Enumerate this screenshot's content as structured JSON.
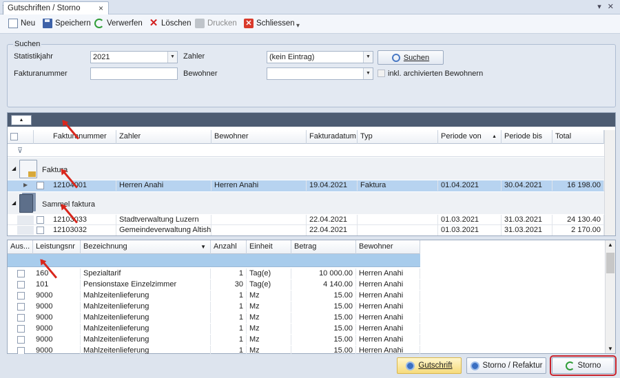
{
  "tab": {
    "title": "Gutschriften / Storno",
    "close": "×"
  },
  "toolbar": {
    "new": "Neu",
    "save": "Speichern",
    "discard": "Verwerfen",
    "delete": "Löschen",
    "print": "Drucken",
    "close": "Schliessen"
  },
  "search": {
    "legend": "Suchen",
    "year_label": "Statistikjahr",
    "year_value": "2021",
    "payer_label": "Zahler",
    "payer_value": "(kein Eintrag)",
    "invoice_label": "Fakturanummer",
    "invoice_value": "",
    "resident_label": "Bewohner",
    "resident_value": "",
    "archived_label": "inkl. archivierten Bewohnern",
    "search_button": "Suchen"
  },
  "grid1": {
    "columns": [
      "Fakturanummer",
      "Zahler",
      "Bewohner",
      "Fakturadatum",
      "Typ",
      "Periode von",
      "Periode bis",
      "Total"
    ],
    "groups": [
      {
        "name": "Faktura",
        "rows": [
          {
            "nr": "12104001",
            "payer": "Herren Anahi",
            "resident": "Herren Anahi",
            "date": "19.04.2021",
            "type": "Faktura",
            "from": "01.04.2021",
            "to": "30.04.2021",
            "total": "16 198.00"
          }
        ]
      },
      {
        "name": "Sammel faktura",
        "rows": [
          {
            "nr": "12103033",
            "payer": "Stadtverwaltung Luzern",
            "resident": "",
            "date": "22.04.2021",
            "type": "",
            "from": "01.03.2021",
            "to": "31.03.2021",
            "total": "24 130.40"
          },
          {
            "nr": "12103032",
            "payer": "Gemeindeverwaltung Altish...",
            "resident": "",
            "date": "22.04.2021",
            "type": "",
            "from": "01.03.2021",
            "to": "31.03.2021",
            "total": "2 170.00"
          }
        ]
      }
    ]
  },
  "grid2": {
    "columns": [
      "Aus...",
      "Leistungsnr",
      "Bezeichnung",
      "Anzahl",
      "Einheit",
      "Betrag",
      "Bewohner"
    ],
    "rows": [
      {
        "nr": "160",
        "desc": "Spezialtarif",
        "qty": "1",
        "unit": "Tag(e)",
        "amount": "10 000.00",
        "resident": "Herren Anahi"
      },
      {
        "nr": "101",
        "desc": "Pensionstaxe Einzelzimmer",
        "qty": "30",
        "unit": "Tag(e)",
        "amount": "4 140.00",
        "resident": "Herren Anahi"
      },
      {
        "nr": "9000",
        "desc": "Mahlzeitenlieferung",
        "qty": "1",
        "unit": "Mz",
        "amount": "15.00",
        "resident": "Herren Anahi"
      },
      {
        "nr": "9000",
        "desc": "Mahlzeitenlieferung",
        "qty": "1",
        "unit": "Mz",
        "amount": "15.00",
        "resident": "Herren Anahi"
      },
      {
        "nr": "9000",
        "desc": "Mahlzeitenlieferung",
        "qty": "1",
        "unit": "Mz",
        "amount": "15.00",
        "resident": "Herren Anahi"
      },
      {
        "nr": "9000",
        "desc": "Mahlzeitenlieferung",
        "qty": "1",
        "unit": "Mz",
        "amount": "15.00",
        "resident": "Herren Anahi"
      },
      {
        "nr": "9000",
        "desc": "Mahlzeitenlieferung",
        "qty": "1",
        "unit": "Mz",
        "amount": "15.00",
        "resident": "Herren Anahi"
      },
      {
        "nr": "9000",
        "desc": "Mahlzeitenlieferung",
        "qty": "1",
        "unit": "Mz",
        "amount": "15.00",
        "resident": "Herren Anahi"
      }
    ]
  },
  "footer": {
    "credit": "Gutschrift",
    "storno_reinvoice": "Storno / Refaktur",
    "storno": "Storno"
  }
}
